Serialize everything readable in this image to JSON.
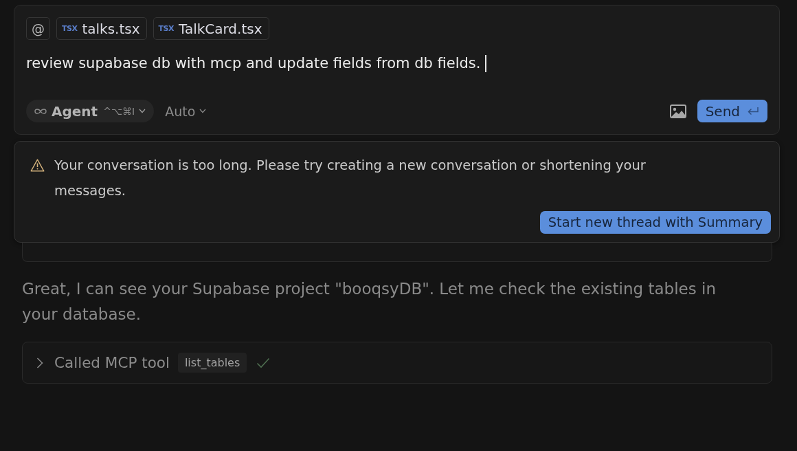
{
  "composer": {
    "mention_button": "@",
    "attachments": [
      {
        "kind": "tsx",
        "badge": "TSX",
        "name": "talks.tsx"
      },
      {
        "kind": "tsx",
        "badge": "TSX",
        "name": "TalkCard.tsx"
      }
    ],
    "value": "review supabase db with mcp and update fields from db fields.",
    "mode": {
      "label": "Agent",
      "shortcut": "^⌥⌘I"
    },
    "model": {
      "label": "Auto"
    },
    "send_button": {
      "label": "Send"
    }
  },
  "error_popup": {
    "message": "Your conversation is too long. Please try creating a new conversation or shortening your messages.",
    "action": "Start new thread with Summary"
  },
  "conversation": [
    {
      "kind": "covered-card"
    },
    {
      "kind": "message",
      "text": "Great, I can see your Supabase project \"booqsyDB\". Let me check the existing tables in your database."
    },
    {
      "kind": "tool-call",
      "label": "Called MCP tool",
      "tool": "list_tables",
      "expanded": false,
      "done": true
    }
  ]
}
